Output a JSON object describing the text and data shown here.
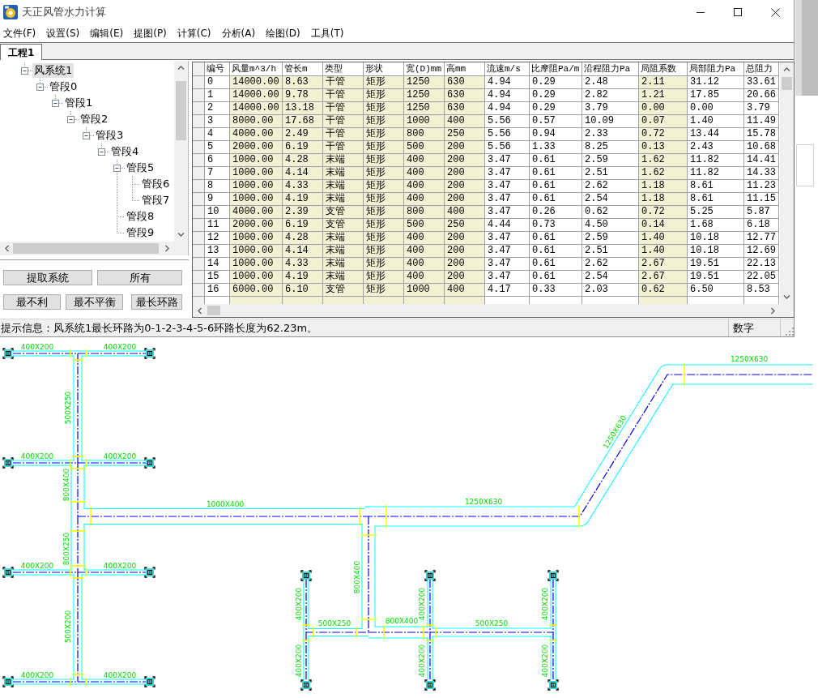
{
  "window": {
    "title": "天正风管水力计算"
  },
  "menu": [
    "文件(F)",
    "设置(S)",
    "编辑(E)",
    "提图(P)",
    "计算(C)",
    "分析(A)",
    "绘图(D)",
    "工具(T)"
  ],
  "tabs": [
    {
      "label": "工程1",
      "selected": true
    }
  ],
  "tree": [
    {
      "label": "风系统1",
      "expanded": true,
      "selected": true,
      "children": [
        {
          "label": "管段0",
          "expanded": true,
          "selected": false,
          "children": [
            {
              "label": "管段1",
              "expanded": true,
              "selected": false,
              "children": [
                {
                  "label": "管段2",
                  "expanded": true,
                  "selected": false,
                  "children": [
                    {
                      "label": "管段3",
                      "expanded": true,
                      "selected": false,
                      "children": [
                        {
                          "label": "管段4",
                          "expanded": true,
                          "selected": false,
                          "children": [
                            {
                              "label": "管段5",
                              "expanded": true,
                              "selected": false,
                              "children": [
                                {
                                  "label": "管段6",
                                  "selected": false
                                },
                                {
                                  "label": "管段7",
                                  "selected": false
                                }
                              ]
                            },
                            {
                              "label": "管段8",
                              "selected": false
                            },
                            {
                              "label": "管段9",
                              "selected": false
                            }
                          ]
                        }
                      ]
                    }
                  ]
                }
              ]
            }
          ]
        }
      ]
    }
  ],
  "button_rows": [
    [
      "提取系统",
      "所有"
    ],
    [
      "最不利",
      "最不平衡",
      "最长环路"
    ]
  ],
  "table": {
    "columns": [
      {
        "label": "编号",
        "highlighted": false
      },
      {
        "label": "风量m^3/h",
        "highlighted": true
      },
      {
        "label": "管长m",
        "highlighted": true
      },
      {
        "label": "类型",
        "highlighted": true
      },
      {
        "label": "形状",
        "highlighted": true
      },
      {
        "label": "宽(D)mm",
        "highlighted": true
      },
      {
        "label": "高mm",
        "highlighted": true
      },
      {
        "label": "流速m/s",
        "highlighted": false
      },
      {
        "label": "比摩阻Pa/m",
        "highlighted": false
      },
      {
        "label": "沿程阻力Pa",
        "highlighted": false
      },
      {
        "label": "局阻系数",
        "highlighted": true
      },
      {
        "label": "局部阻力Pa",
        "highlighted": false
      },
      {
        "label": "总阻力",
        "highlighted": false
      }
    ],
    "rows": [
      [
        "0",
        "14000.00",
        "8.63",
        "干管",
        "矩形",
        "1250",
        "630",
        "4.94",
        "0.29",
        "2.48",
        "2.11",
        "31.12",
        "33.61"
      ],
      [
        "1",
        "14000.00",
        "9.78",
        "干管",
        "矩形",
        "1250",
        "630",
        "4.94",
        "0.29",
        "2.82",
        "1.21",
        "17.85",
        "20.66"
      ],
      [
        "2",
        "14000.00",
        "13.18",
        "干管",
        "矩形",
        "1250",
        "630",
        "4.94",
        "0.29",
        "3.79",
        "0.00",
        "0.00",
        "3.79"
      ],
      [
        "3",
        "8000.00",
        "17.68",
        "干管",
        "矩形",
        "1000",
        "400",
        "5.56",
        "0.57",
        "10.09",
        "0.07",
        "1.40",
        "11.49"
      ],
      [
        "4",
        "4000.00",
        "2.49",
        "干管",
        "矩形",
        "800",
        "250",
        "5.56",
        "0.94",
        "2.33",
        "0.72",
        "13.44",
        "15.78"
      ],
      [
        "5",
        "2000.00",
        "6.19",
        "干管",
        "矩形",
        "500",
        "200",
        "5.56",
        "1.33",
        "8.25",
        "0.13",
        "2.43",
        "10.68"
      ],
      [
        "6",
        "1000.00",
        "4.28",
        "末端",
        "矩形",
        "400",
        "200",
        "3.47",
        "0.61",
        "2.59",
        "1.62",
        "11.82",
        "14.41"
      ],
      [
        "7",
        "1000.00",
        "4.14",
        "末端",
        "矩形",
        "400",
        "200",
        "3.47",
        "0.61",
        "2.51",
        "1.62",
        "11.82",
        "14.33"
      ],
      [
        "8",
        "1000.00",
        "4.33",
        "末端",
        "矩形",
        "400",
        "200",
        "3.47",
        "0.61",
        "2.62",
        "1.18",
        "8.61",
        "11.23"
      ],
      [
        "9",
        "1000.00",
        "4.19",
        "末端",
        "矩形",
        "400",
        "200",
        "3.47",
        "0.61",
        "2.54",
        "1.18",
        "8.61",
        "11.15"
      ],
      [
        "10",
        "4000.00",
        "2.39",
        "支管",
        "矩形",
        "800",
        "400",
        "3.47",
        "0.26",
        "0.62",
        "0.72",
        "5.25",
        "5.87"
      ],
      [
        "11",
        "2000.00",
        "6.19",
        "支管",
        "矩形",
        "500",
        "250",
        "4.44",
        "0.73",
        "4.50",
        "0.14",
        "1.68",
        "6.18"
      ],
      [
        "12",
        "1000.00",
        "4.28",
        "末端",
        "矩形",
        "400",
        "200",
        "3.47",
        "0.61",
        "2.59",
        "1.40",
        "10.18",
        "12.77"
      ],
      [
        "13",
        "1000.00",
        "4.14",
        "末端",
        "矩形",
        "400",
        "200",
        "3.47",
        "0.61",
        "2.51",
        "1.40",
        "10.18",
        "12.69"
      ],
      [
        "14",
        "1000.00",
        "4.33",
        "末端",
        "矩形",
        "400",
        "200",
        "3.47",
        "0.61",
        "2.62",
        "2.67",
        "19.51",
        "22.13"
      ],
      [
        "15",
        "1000.00",
        "4.19",
        "末端",
        "矩形",
        "400",
        "200",
        "3.47",
        "0.61",
        "2.54",
        "2.67",
        "19.51",
        "22.05"
      ],
      [
        "16",
        "6000.00",
        "6.10",
        "支管",
        "矩形",
        "1000",
        "400",
        "4.17",
        "0.33",
        "2.03",
        "0.62",
        "6.50",
        "8.53"
      ]
    ]
  },
  "status_bar": {
    "message": "提示信息：风系统1最长环路为0-1-2-3-4-5-6环路长度为62.23m。",
    "panels": [
      "数字"
    ]
  },
  "drawing": {
    "duct_labels": [
      "400X200",
      "400X200",
      "500X250",
      "400X200",
      "400X200",
      "800X400",
      "1000X400",
      "800X250",
      "400X200",
      "400X200",
      "500X200",
      "400X200",
      "400X200",
      "800X400",
      "400X200",
      "400X200",
      "500X250",
      "800X400",
      "400X200",
      "400X200",
      "500X250",
      "400X200",
      "400X200",
      "1250X630",
      "1250X630",
      "1250X630"
    ]
  }
}
